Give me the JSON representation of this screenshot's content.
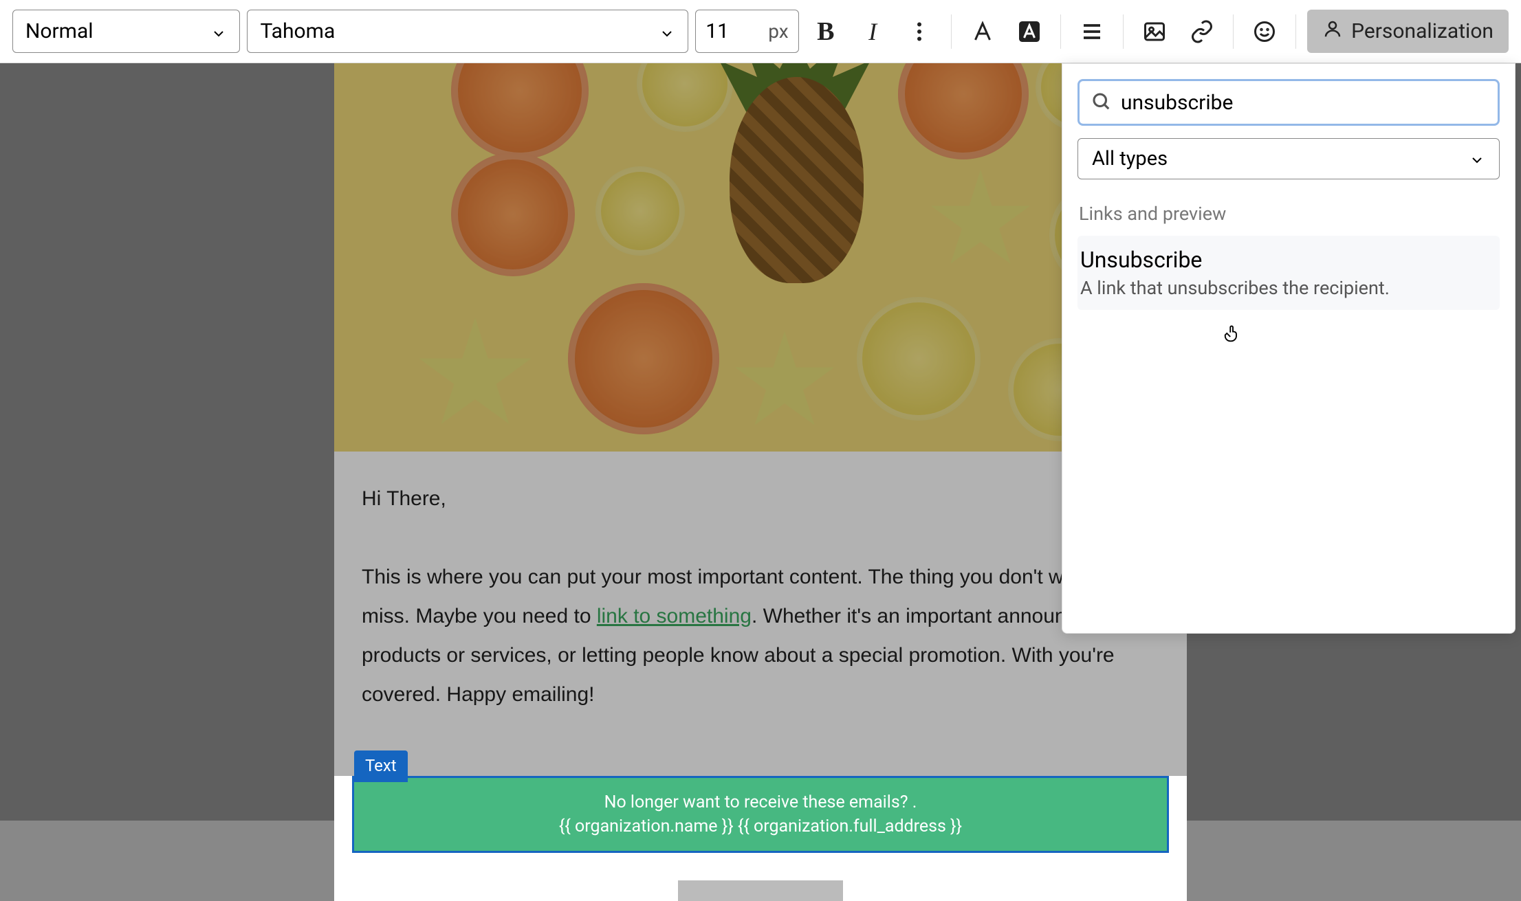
{
  "toolbar": {
    "style_select": "Normal",
    "font_select": "Tahoma",
    "font_size": "11",
    "font_size_unit": "px",
    "personalization_label": "Personalization"
  },
  "panel": {
    "search_value": "unsubscribe",
    "filter_label": "All types",
    "section_label": "Links and preview",
    "results": [
      {
        "title": "Unsubscribe",
        "desc": "A link that unsubscribes the recipient."
      }
    ]
  },
  "email": {
    "greeting": "Hi There,",
    "body_before_link": "This is where you can put your most important content. The thing you don't want to miss. Maybe you need to ",
    "link_text": "link to something",
    "body_after_link": ". Whether it's an important announc new products or services, or letting people know about a special promotion. With you're covered. Happy emailing!",
    "block_label": "Text",
    "footer_line1": "No longer want to receive these emails? .",
    "footer_line2": "{{ organization.name }} {{ organization.full_address }}"
  }
}
